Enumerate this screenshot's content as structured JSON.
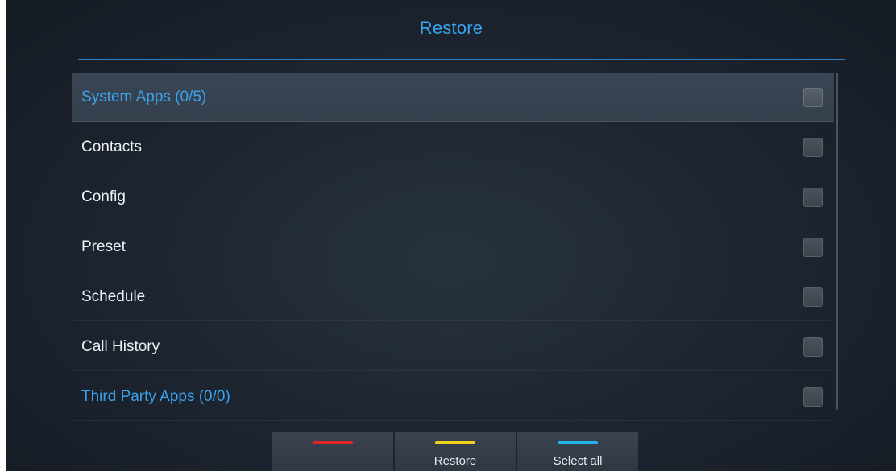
{
  "header": {
    "title": "Restore"
  },
  "list": {
    "items": [
      {
        "label": "System Apps  (0/5)",
        "type": "group",
        "focused": true,
        "checked": false
      },
      {
        "label": "Contacts",
        "type": "item",
        "focused": false,
        "checked": false
      },
      {
        "label": "Config",
        "type": "item",
        "focused": false,
        "checked": false
      },
      {
        "label": "Preset",
        "type": "item",
        "focused": false,
        "checked": false
      },
      {
        "label": "Schedule",
        "type": "item",
        "focused": false,
        "checked": false
      },
      {
        "label": "Call History",
        "type": "item",
        "focused": false,
        "checked": false
      },
      {
        "label": "Third Party Apps  (0/0)",
        "type": "group",
        "focused": false,
        "checked": false
      }
    ]
  },
  "softkeys": [
    {
      "label": "",
      "color": "#e0252b"
    },
    {
      "label": "Restore",
      "color": "#f2d21b"
    },
    {
      "label": "Select all",
      "color": "#22b4e6"
    }
  ],
  "colors": {
    "accent": "#3aa3ee",
    "rule": "#2f7fc4"
  }
}
